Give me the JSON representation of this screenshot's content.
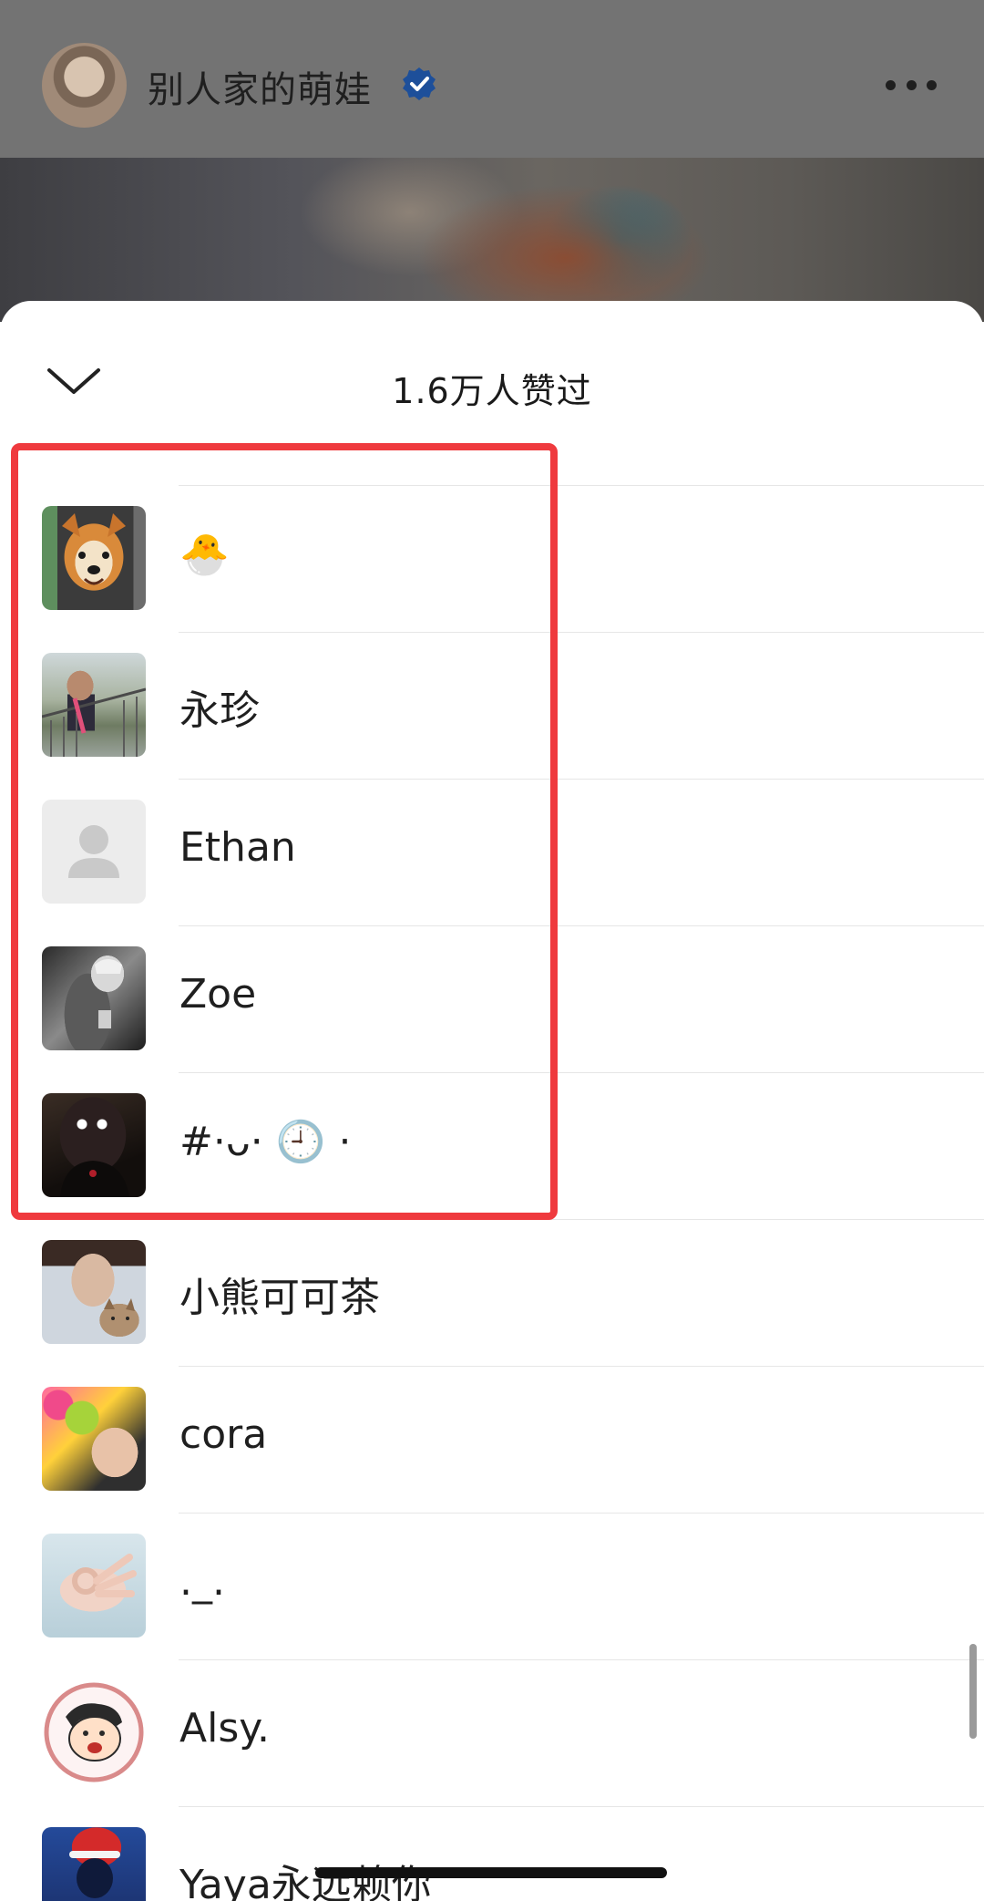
{
  "post_header": {
    "username": "别人家的萌娃",
    "verified_icon": "verified-badge-icon",
    "more_icon": "more-horizontal-icon"
  },
  "sheet": {
    "title": "1.6万人赞过",
    "collapse_icon": "chevron-down-icon"
  },
  "likers": [
    {
      "name": "🐣",
      "avatar": "shiba-dog-avatar"
    },
    {
      "name": "永珍",
      "avatar": "woman-on-bridge-avatar"
    },
    {
      "name": "Ethan",
      "avatar": "default-user-avatar"
    },
    {
      "name": "Zoe",
      "avatar": "black-white-photo-avatar"
    },
    {
      "name": "#·ᴗ· 🕘 ·",
      "avatar": "dark-figure-avatar"
    },
    {
      "name": "小熊可可茶",
      "avatar": "girl-with-cat-avatar"
    },
    {
      "name": "cora",
      "avatar": "balloons-avatar"
    },
    {
      "name": "._.",
      "avatar": "hand-gesture-avatar"
    },
    {
      "name": "Alsy.",
      "avatar": "cartoon-boy-avatar"
    },
    {
      "name": "Yaya永远赖你",
      "avatar": "santa-hat-avatar"
    }
  ],
  "annotation": {
    "highlight_color": "#ef3a3e",
    "highlighted_rows": [
      "🐣",
      "永珍",
      "Ethan",
      "Zoe",
      "#·ᴗ· 🕘 ·"
    ]
  }
}
